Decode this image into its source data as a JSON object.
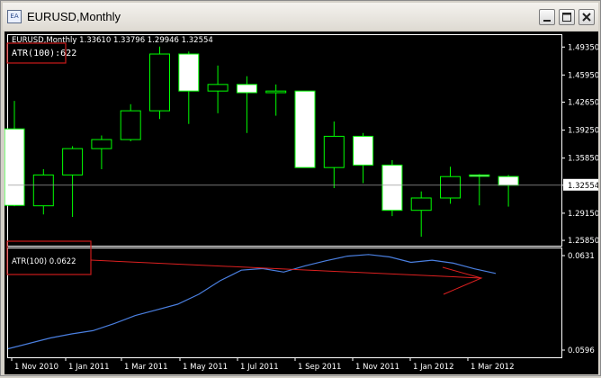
{
  "window": {
    "title": "EURUSD,Monthly",
    "app_icon_text": "EA",
    "buttons": {
      "minimize": "minimize",
      "maximize": "maximize",
      "close": "close"
    }
  },
  "chart": {
    "info_line": "EURUSD,Monthly  1.33610 1.33796 1.29946 1.32554",
    "atr_box_label": "ATR(100):622",
    "indicator_label": "ATR(100) 0.0622",
    "current_price_label": "1.32554",
    "price_labels": [
      "1.49350",
      "1.45950",
      "1.42650",
      "1.39250",
      "1.35850",
      "1.32554",
      "1.29150",
      "1.25850"
    ],
    "indicator_labels": [
      "0.0631",
      "0.0596"
    ],
    "time_labels": [
      "1 Nov 2010",
      "1 Jan 2011",
      "1 Mar 2011",
      "1 May 2011",
      "1 Jul 2011",
      "1 Sep 2011",
      "1 Nov 2011",
      "1 Jan 2012",
      "1 Mar 2012"
    ],
    "colors": {
      "background": "#000000",
      "bull_fill": "#000000",
      "bear_fill": "#ffffff",
      "candle_outline": "#00ff00",
      "atr_line": "#4a7fe0",
      "arrow": "#dd2020",
      "box": "#cc1a1a"
    }
  },
  "chart_data": {
    "type": "candlestick",
    "title": "EURUSD,Monthly",
    "ylim": [
      1.252,
      1.508
    ],
    "candles": [
      {
        "o": 1.394,
        "h": 1.428,
        "l": 1.3,
        "c": 1.301
      },
      {
        "o": 1.3005,
        "h": 1.345,
        "l": 1.29,
        "c": 1.338
      },
      {
        "o": 1.338,
        "h": 1.373,
        "l": 1.287,
        "c": 1.37
      },
      {
        "o": 1.37,
        "h": 1.386,
        "l": 1.345,
        "c": 1.381
      },
      {
        "o": 1.381,
        "h": 1.424,
        "l": 1.379,
        "c": 1.416
      },
      {
        "o": 1.416,
        "h": 1.494,
        "l": 1.406,
        "c": 1.485
      },
      {
        "o": 1.485,
        "h": 1.488,
        "l": 1.4,
        "c": 1.44
      },
      {
        "o": 1.44,
        "h": 1.471,
        "l": 1.413,
        "c": 1.448
      },
      {
        "o": 1.448,
        "h": 1.458,
        "l": 1.389,
        "c": 1.438
      },
      {
        "o": 1.438,
        "h": 1.448,
        "l": 1.41,
        "c": 1.44
      },
      {
        "o": 1.44,
        "h": 1.44,
        "l": 1.349,
        "c": 1.347
      },
      {
        "o": 1.347,
        "h": 1.403,
        "l": 1.322,
        "c": 1.385
      },
      {
        "o": 1.385,
        "h": 1.389,
        "l": 1.328,
        "c": 1.35
      },
      {
        "o": 1.35,
        "h": 1.356,
        "l": 1.288,
        "c": 1.295
      },
      {
        "o": 1.295,
        "h": 1.318,
        "l": 1.263,
        "c": 1.31
      },
      {
        "o": 1.31,
        "h": 1.348,
        "l": 1.303,
        "c": 1.336
      },
      {
        "o": 1.338,
        "h": 1.339,
        "l": 1.301,
        "c": 1.337
      },
      {
        "o": 1.3361,
        "h": 1.338,
        "l": 1.2995,
        "c": 1.3255
      }
    ],
    "atr_ylim": [
      0.0594,
      0.0633
    ],
    "atr_values": [
      0.05965,
      0.05985,
      0.06005,
      0.0602,
      0.06032,
      0.06058,
      0.06088,
      0.06109,
      0.0613,
      0.06167,
      0.06217,
      0.06256,
      0.06262,
      0.06249,
      0.06272,
      0.06291,
      0.06308,
      0.06314,
      0.06305,
      0.06285,
      0.06293,
      0.06282,
      0.06261,
      0.06244
    ]
  }
}
